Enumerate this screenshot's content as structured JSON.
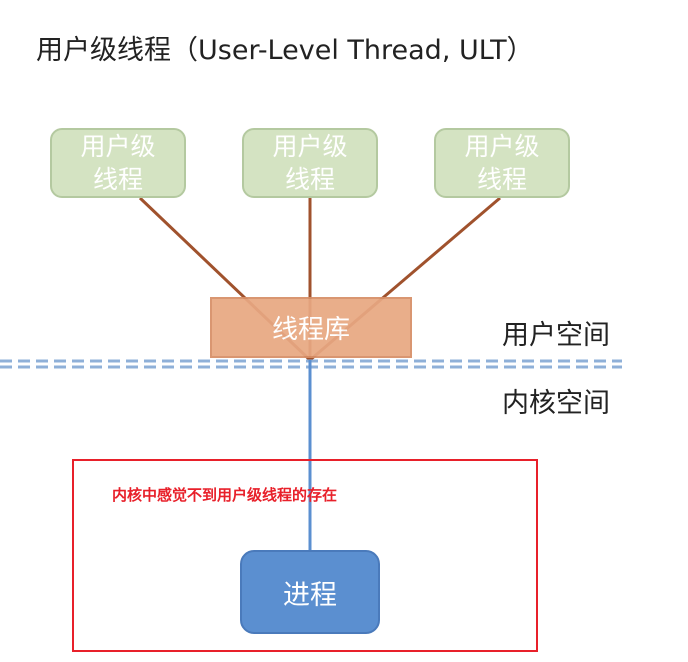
{
  "title": "用户级线程（User-Level Thread, ULT）",
  "user_threads": [
    {
      "line1": "用户级",
      "line2": "线程"
    },
    {
      "line1": "用户级",
      "line2": "线程"
    },
    {
      "line1": "用户级",
      "line2": "线程"
    }
  ],
  "thread_library": "线程库",
  "user_space_label": "用户空间",
  "kernel_space_label": "内核空间",
  "kernel_note": "内核中感觉不到用户级线程的存在",
  "process_label": "进程",
  "colors": {
    "user_thread_fill": "#d4e3c2",
    "thread_library_fill": "#e8a882",
    "process_fill": "#5b8fd0",
    "connector_brown": "#a0522d",
    "connector_blue": "#5b8fd0",
    "boundary_dashed": "#8fb0d8",
    "note_red": "#e8202a"
  }
}
